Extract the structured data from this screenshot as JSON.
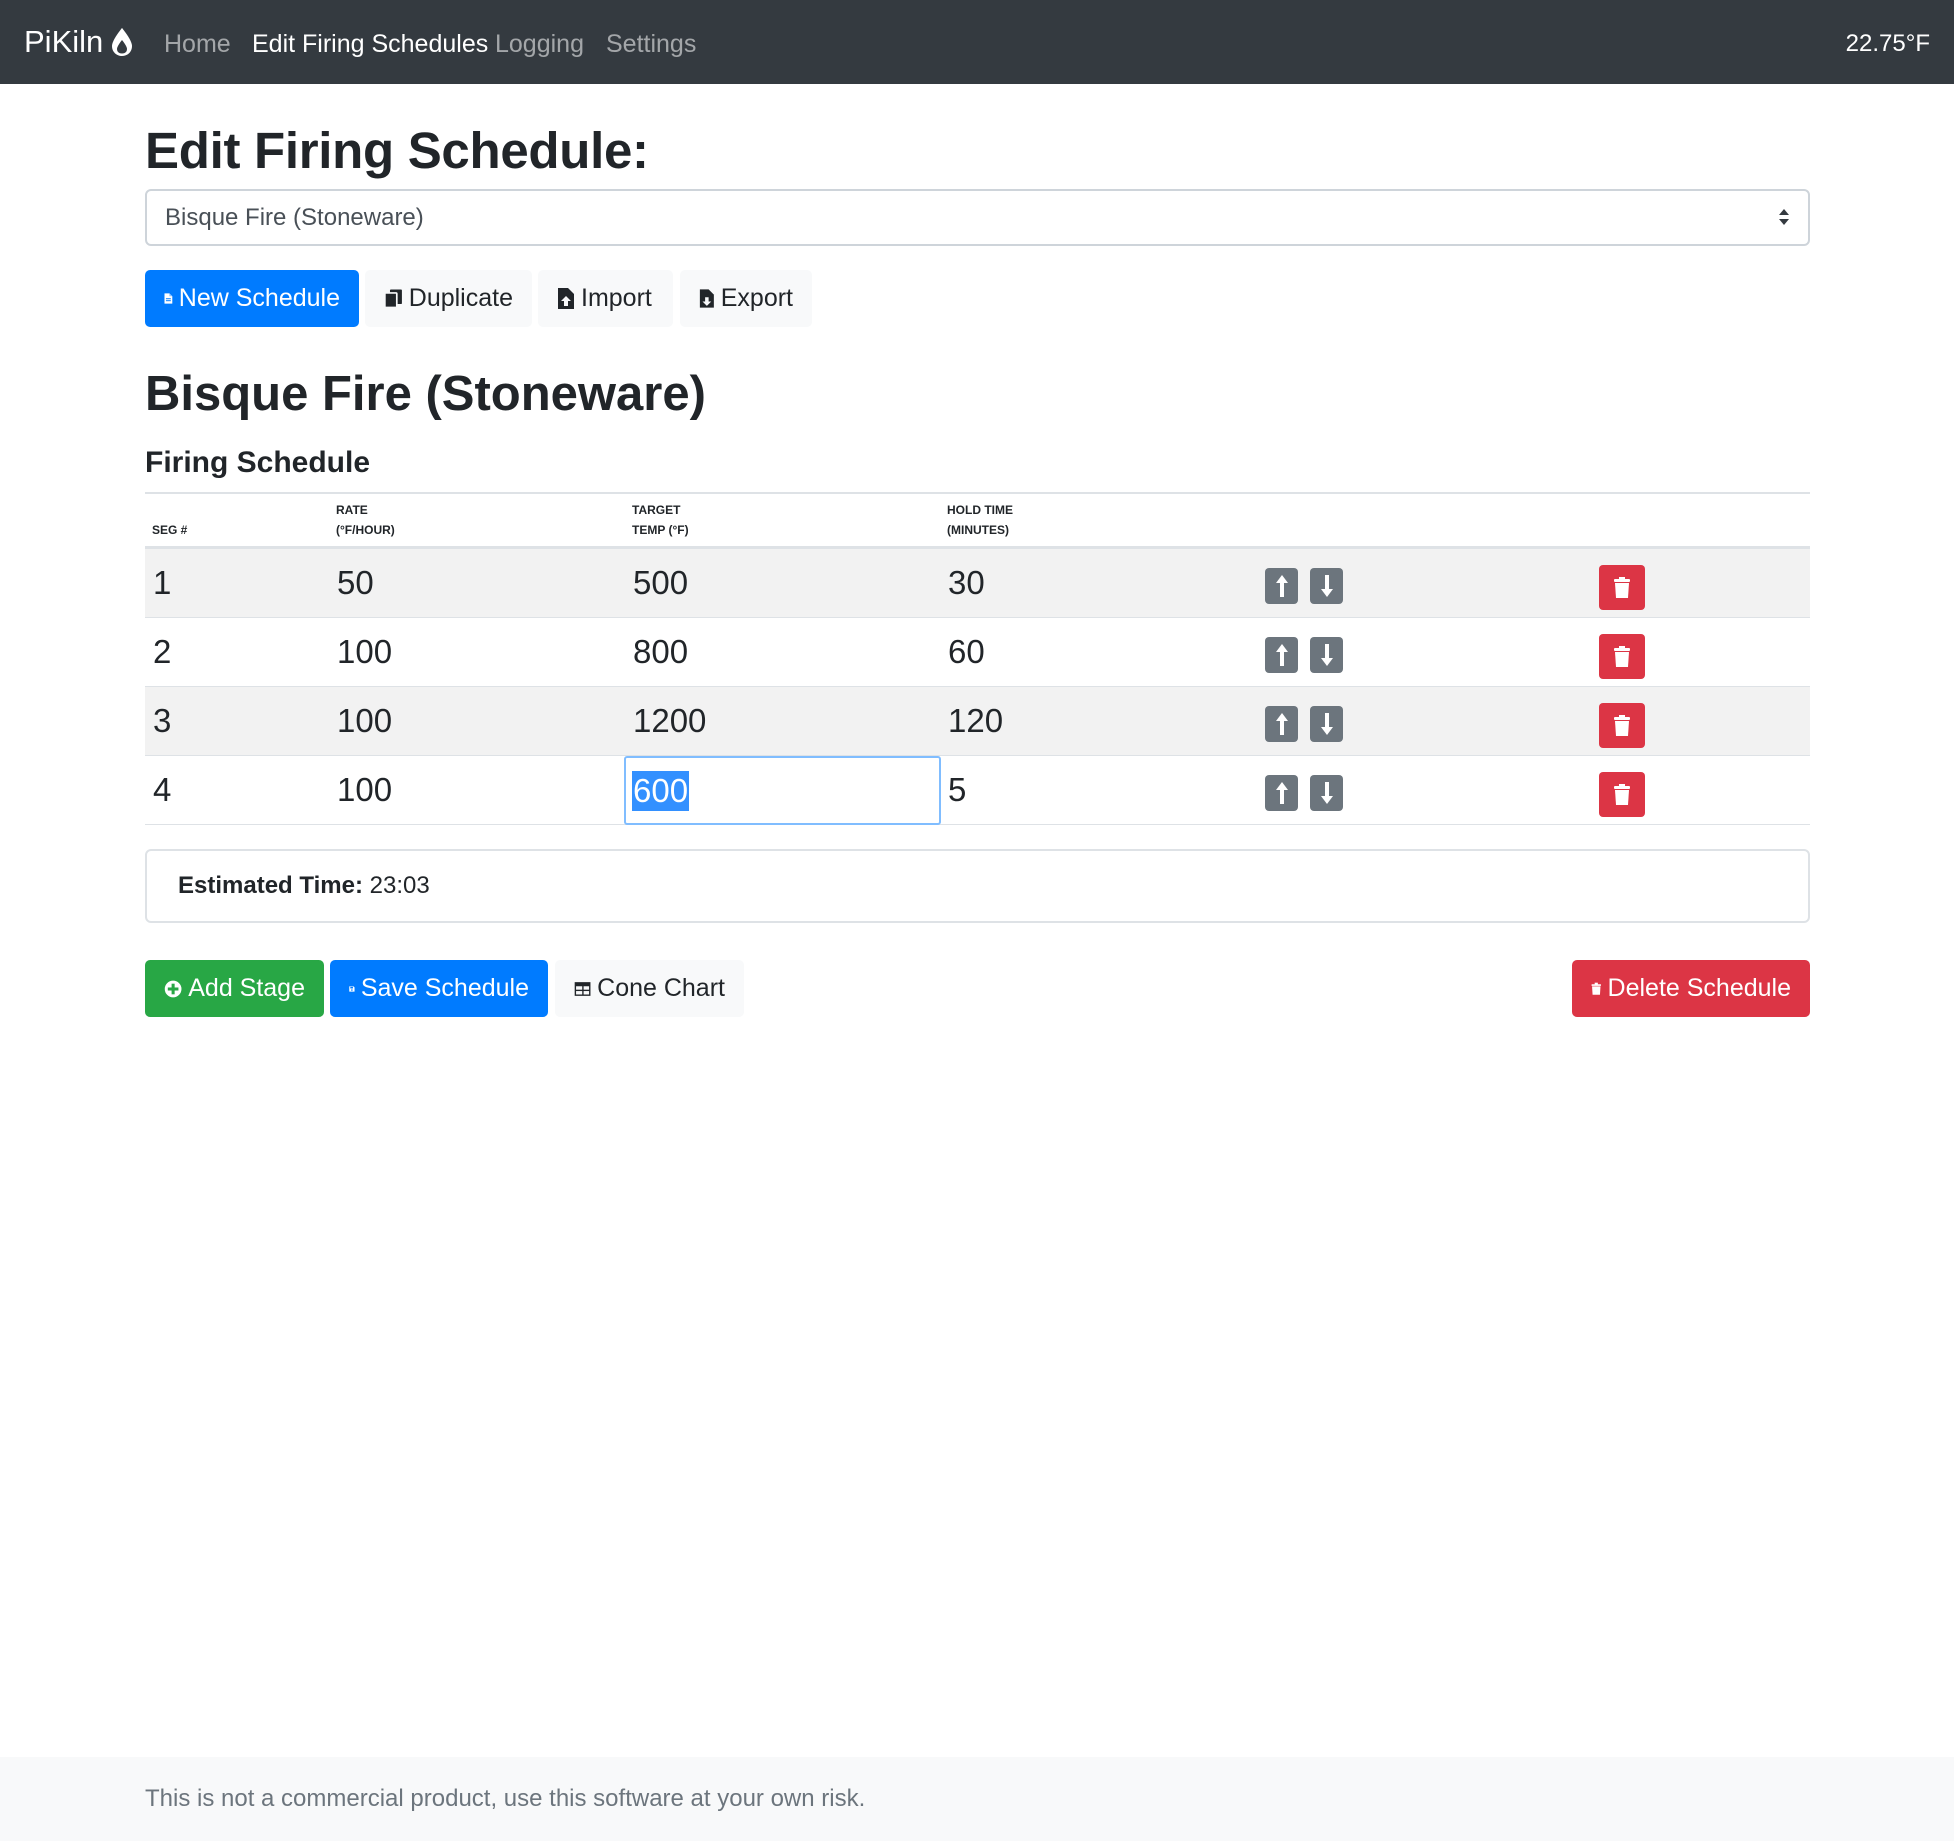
{
  "navbar": {
    "brand": "PiKiln",
    "links": [
      {
        "label": "Home",
        "active": false
      },
      {
        "label": "Edit Firing Schedules",
        "active": true
      },
      {
        "label": "Logging",
        "active": false
      },
      {
        "label": "Settings",
        "active": false
      }
    ],
    "temperature": "22.75°F"
  },
  "page_title": "Edit Firing Schedule:",
  "schedule_select": {
    "value": "Bisque Fire (Stoneware)"
  },
  "top_buttons": {
    "new": "New Schedule",
    "duplicate": "Duplicate",
    "import": "Import",
    "export": "Export"
  },
  "schedule_name": "Bisque Fire (Stoneware)",
  "section_title": "Firing Schedule",
  "table": {
    "headers": {
      "seg": "SEG #",
      "rate_1": "RATE",
      "rate_2": "(°F/HOUR)",
      "target_1": "TARGET",
      "target_2": "TEMP (°F)",
      "hold_1": "HOLD TIME",
      "hold_2": "(MINUTES)"
    },
    "rows": [
      {
        "seg": "1",
        "rate": "50",
        "target": "500",
        "hold": "30"
      },
      {
        "seg": "2",
        "rate": "100",
        "target": "800",
        "hold": "60"
      },
      {
        "seg": "3",
        "rate": "100",
        "target": "1200",
        "hold": "120"
      },
      {
        "seg": "4",
        "rate": "100",
        "target": "600",
        "hold": "5"
      }
    ]
  },
  "estimate": {
    "label": "Estimated Time:",
    "value": "23:03"
  },
  "bottom_buttons": {
    "add_stage": "Add Stage",
    "save": "Save Schedule",
    "cone_chart": "Cone Chart",
    "delete": "Delete Schedule"
  },
  "footer_text": "This is not a commercial product, use this software at your own risk.",
  "colors": {
    "navbar": "#343a40",
    "primary": "#007bff",
    "success": "#28a745",
    "danger": "#dc3545",
    "secondary": "#6c757d"
  }
}
